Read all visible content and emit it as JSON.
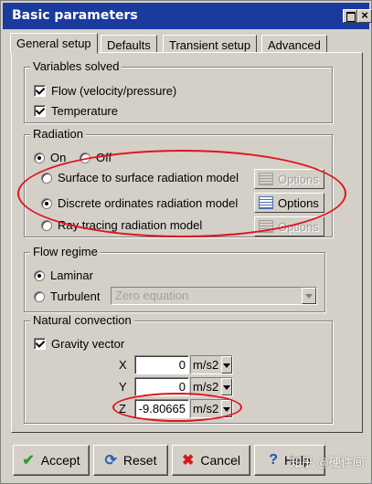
{
  "window": {
    "title": "Basic parameters",
    "close_glyph": "×"
  },
  "tabs": [
    {
      "label": "General setup",
      "active": true
    },
    {
      "label": "Defaults",
      "active": false
    },
    {
      "label": "Transient setup",
      "active": false
    },
    {
      "label": "Advanced",
      "active": false
    }
  ],
  "variables": {
    "title": "Variables solved",
    "flow_label": "Flow (velocity/pressure)",
    "flow_checked": true,
    "temperature_label": "Temperature",
    "temperature_checked": true
  },
  "radiation": {
    "title": "Radiation",
    "on_label": "On",
    "off_label": "Off",
    "selected": "On",
    "models": [
      {
        "label": "Surface to surface radiation model",
        "selected": false,
        "options_enabled": false
      },
      {
        "label": "Discrete ordinates radiation model",
        "selected": true,
        "options_enabled": true
      },
      {
        "label": "Ray tracing radiation model",
        "selected": false,
        "options_enabled": false
      }
    ],
    "options_label": "Options"
  },
  "flow_regime": {
    "title": "Flow regime",
    "laminar_label": "Laminar",
    "turbulent_label": "Turbulent",
    "selected": "Laminar",
    "turbulence_model": "Zero equation"
  },
  "natural_convection": {
    "title": "Natural convection",
    "gravity_label": "Gravity vector",
    "gravity_checked": true,
    "x_label": "X",
    "x_value": "0",
    "y_label": "Y",
    "y_value": "0",
    "z_label": "Z",
    "z_value": "-9.80665",
    "unit": "m/s2"
  },
  "footer": {
    "accept_label": "Accept",
    "reset_label": "Reset",
    "cancel_label": "Cancel",
    "help_label": "Help"
  },
  "watermark": "知乎 @硬件间",
  "colors": {
    "titlebar": "#1a3a9e",
    "annotation": "#e0141e",
    "accept_icon": "#2e9e2e",
    "reset_icon": "#2d5fb5",
    "cancel_icon": "#d01c1c",
    "help_icon": "#1f4fb0"
  },
  "icons": [
    "close-icon",
    "maximize-icon",
    "options-icon",
    "check-icon",
    "reset-icon",
    "cancel-icon",
    "help-icon"
  ]
}
